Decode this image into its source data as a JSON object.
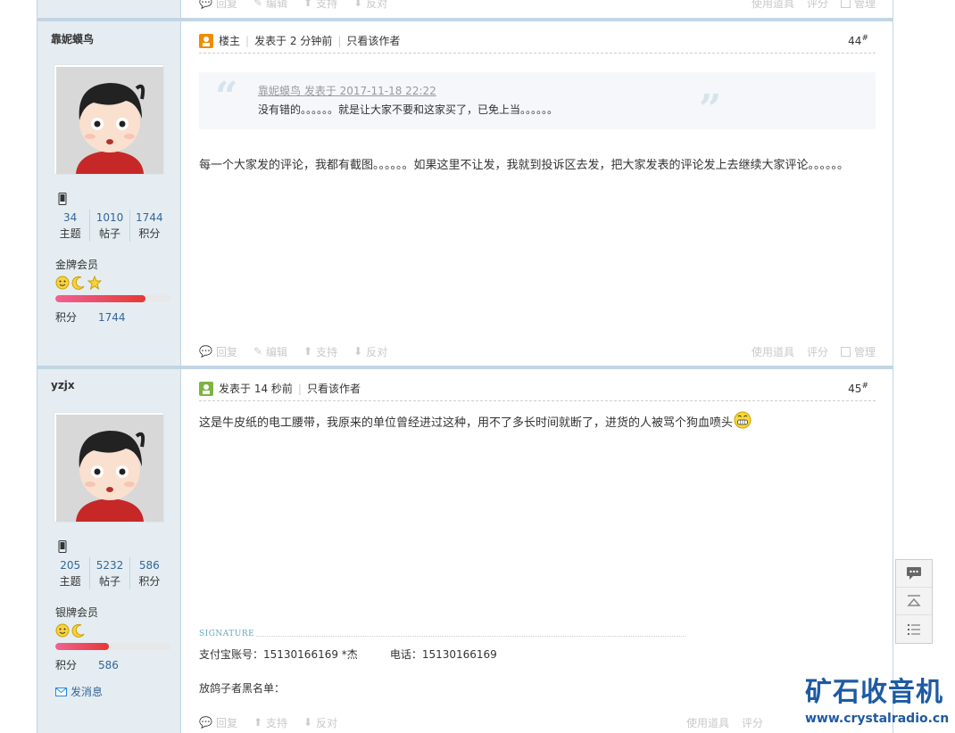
{
  "top_footer": {
    "reply": "回复",
    "edit": "编辑",
    "support": "支持",
    "oppose": "反对",
    "tools": "使用道具",
    "rate": "评分",
    "manage": "管理"
  },
  "posts": [
    {
      "username": "靠妮蟆鸟",
      "stats": [
        {
          "value": "34",
          "label": "主题"
        },
        {
          "value": "1010",
          "label": "帖子"
        },
        {
          "value": "1744",
          "label": "积分"
        }
      ],
      "rank": "金牌会员",
      "level_progress": 0.78,
      "points_label": "积分",
      "points": "1744",
      "header": {
        "owner": "楼主",
        "posted": "发表于 2 分钟前",
        "only_author": "只看该作者",
        "floor": "44",
        "floor_sup": "#"
      },
      "quote": {
        "author": "靠妮蟆鸟 发表于 2017-11-18 22:22",
        "text": "没有错的。。。。。。就是让大家不要和这家买了，已免上当。。。。。。"
      },
      "body": "每一个大家发的评论，我都有截图。。。。。。如果这里不让发，我就到投诉区去发，把大家发表的评论发上去继续大家评论。。。。。。",
      "footer": {
        "reply": "回复",
        "edit": "编辑",
        "support": "支持",
        "oppose": "反对",
        "tools": "使用道具",
        "rate": "评分",
        "manage": "管理"
      }
    },
    {
      "username": "yzjx",
      "stats": [
        {
          "value": "205",
          "label": "主题"
        },
        {
          "value": "5232",
          "label": "帖子"
        },
        {
          "value": "586",
          "label": "积分"
        }
      ],
      "rank": "银牌会员",
      "level_progress": 0.46,
      "points_label": "积分",
      "points": "586",
      "send_message": "发消息",
      "header": {
        "posted": "发表于 14 秒前",
        "only_author": "只看该作者",
        "floor": "45",
        "floor_sup": "#"
      },
      "body": "这是牛皮纸的电工腰带，我原来的单位曾经进过这种，用不了多长时间就断了，进货的人被骂个狗血喷头",
      "signature_label": "SIGNATURE",
      "signature_lines": [
        "支付宝账号：15130166169 *杰",
        "电话：15130166169",
        "放鸽子者黑名单："
      ],
      "footer": {
        "reply": "回复",
        "support": "支持",
        "oppose": "反对",
        "tools": "使用道具",
        "rate": "评分"
      }
    }
  ],
  "watermark": {
    "title": "矿石收音机",
    "url": "www.crystalradio.cn"
  },
  "colors": {
    "sidebar_bg": "#e5edf2",
    "border": "#c2d5e3",
    "link": "#336699",
    "brand": "#1d5aa3"
  }
}
